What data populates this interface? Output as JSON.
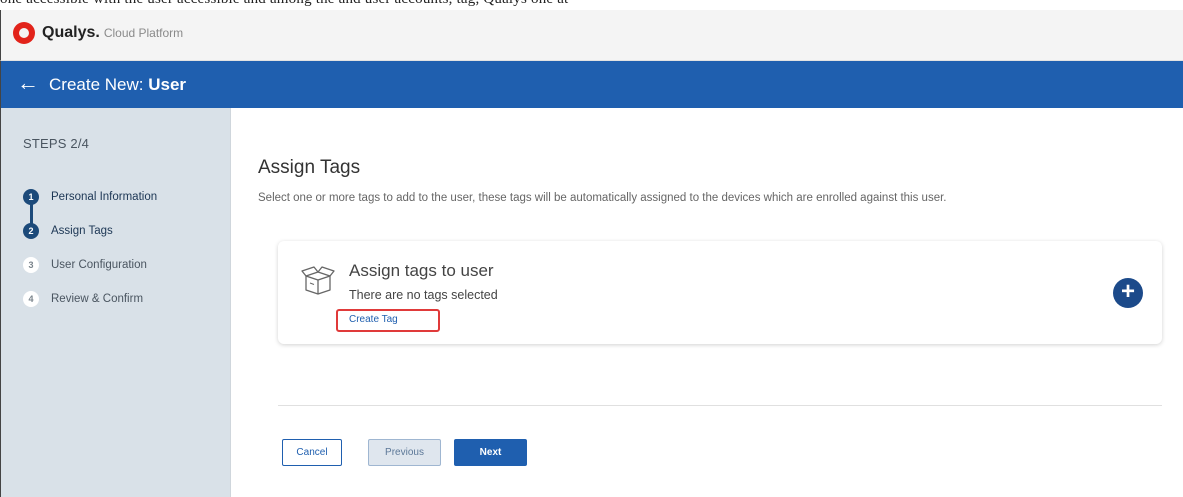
{
  "clipped_text": "one accessible with the user accessible and among the and user accounts, tag, Qualys one at",
  "brand": {
    "name": "Qualys.",
    "product": "Cloud Platform"
  },
  "header": {
    "prefix": "Create New:",
    "entity": "User"
  },
  "sidebar": {
    "steps_title": "STEPS 2/4",
    "steps": [
      {
        "number": "1",
        "label": "Personal Information",
        "state": "completed"
      },
      {
        "number": "2",
        "label": "Assign Tags",
        "state": "active"
      },
      {
        "number": "3",
        "label": "User Configuration",
        "state": "pending"
      },
      {
        "number": "4",
        "label": "Review & Confirm",
        "state": "pending"
      }
    ]
  },
  "main": {
    "title": "Assign Tags",
    "description": "Select one or more tags to add to the user, these tags will be automatically assigned to the devices which are enrolled against this user.",
    "card": {
      "icon": "open-box-icon",
      "title": "Assign tags to user",
      "subtitle": "There are no tags selected",
      "create_link": "Create Tag",
      "add_icon": "plus-circle-icon"
    }
  },
  "footer": {
    "cancel": "Cancel",
    "previous": "Previous",
    "next": "Next"
  },
  "colors": {
    "brand_red": "#e2231a",
    "header_blue": "#1f5faf",
    "sidebar_bg": "#d9e1e8",
    "active_step": "#1c4a7a",
    "highlight_border": "#e03a3a"
  }
}
